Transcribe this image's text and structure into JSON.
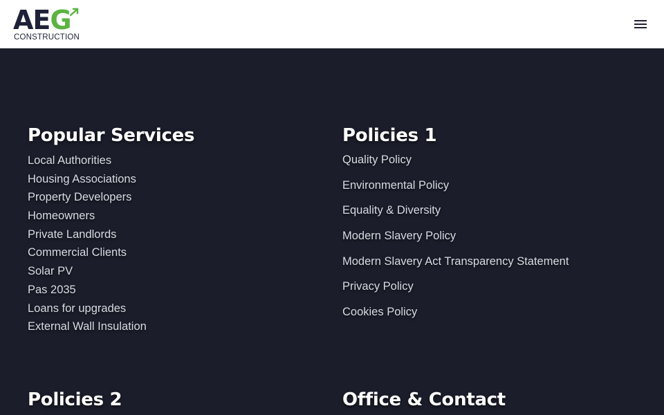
{
  "header": {
    "logo": {
      "letters_ae": "AE",
      "letter_g": "G",
      "subtitle": "CONSTRUCTION"
    },
    "menu_icon": "hamburger-menu-icon"
  },
  "colors": {
    "background": "#1b1d2a",
    "brand_green": "#5cb343",
    "brand_navy": "#1f2137"
  },
  "sections": {
    "popular_services": {
      "title": "Popular Services",
      "items": [
        "Local Authorities",
        "Housing Associations",
        "Property Developers",
        "Homeowners",
        "Private Landlords",
        "Commercial Clients",
        "Solar PV",
        "Pas 2035",
        "Loans for upgrades",
        "External Wall Insulation"
      ]
    },
    "policies_1": {
      "title": "Policies 1",
      "items": [
        "Quality Policy",
        "Environmental Policy",
        "Equality & Diversity",
        "Modern Slavery Policy",
        "Modern Slavery Act Transparency Statement",
        "Privacy Policy",
        "Cookies Policy"
      ]
    },
    "policies_2": {
      "title": "Policies 2"
    },
    "office_contact": {
      "title": "Office & Contact"
    }
  }
}
